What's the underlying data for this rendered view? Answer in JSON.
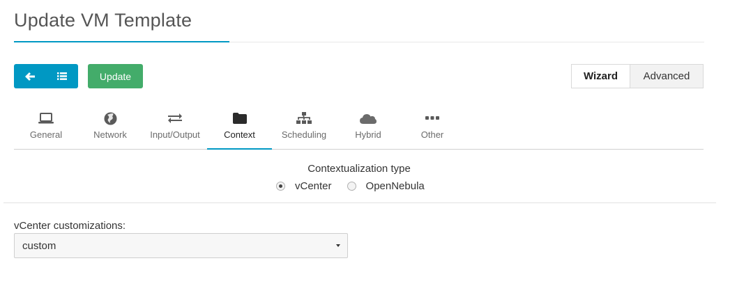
{
  "header": {
    "title": "Update VM Template"
  },
  "toolbar": {
    "back_icon": "arrow-left-icon",
    "list_icon": "list-icon",
    "update_label": "Update",
    "wizard_label": "Wizard",
    "advanced_label": "Advanced"
  },
  "tabs": [
    {
      "label": "General",
      "icon": "laptop-icon",
      "active": false
    },
    {
      "label": "Network",
      "icon": "globe-icon",
      "active": false
    },
    {
      "label": "Input/Output",
      "icon": "exchange-icon",
      "active": false
    },
    {
      "label": "Context",
      "icon": "folder-icon",
      "active": true
    },
    {
      "label": "Scheduling",
      "icon": "sitemap-icon",
      "active": false
    },
    {
      "label": "Hybrid",
      "icon": "cloud-icon",
      "active": false
    },
    {
      "label": "Other",
      "icon": "ellipsis-icon",
      "active": false
    }
  ],
  "context": {
    "type_label": "Contextualization type",
    "options": [
      {
        "label": "vCenter",
        "checked": true
      },
      {
        "label": "OpenNebula",
        "checked": false
      }
    ],
    "customizations_label": "vCenter customizations:",
    "customizations_value": "custom"
  },
  "colors": {
    "accent": "#0098c3",
    "update": "#43ac6a"
  }
}
